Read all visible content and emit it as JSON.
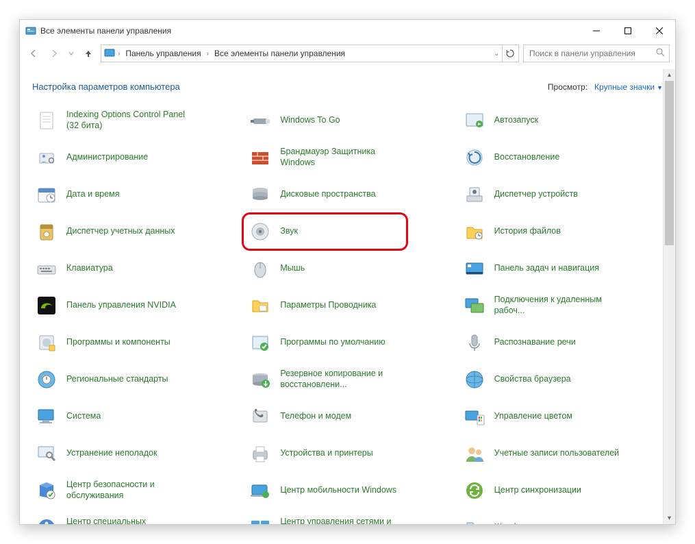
{
  "window_title": "Все элементы панели управления",
  "breadcrumb": {
    "root": "Панель управления",
    "current": "Все элементы панели управления"
  },
  "search_placeholder": "Поиск в панели управления",
  "page_heading": "Настройка параметров компьютера",
  "view_by_label": "Просмотр:",
  "view_by_value": "Крупные значки",
  "highlighted_index": 10,
  "items": [
    {
      "label": "Indexing Options Control Panel (32 бита)",
      "icon": "document"
    },
    {
      "label": "Windows To Go",
      "icon": "usb"
    },
    {
      "label": "Автозапуск",
      "icon": "autoplay"
    },
    {
      "label": "Администрирование",
      "icon": "admin"
    },
    {
      "label": "Брандмауэр Защитника Windows",
      "icon": "firewall"
    },
    {
      "label": "Восстановление",
      "icon": "recovery"
    },
    {
      "label": "Дата и время",
      "icon": "datetime"
    },
    {
      "label": "Дисковые пространства",
      "icon": "storage"
    },
    {
      "label": "Диспетчер устройств",
      "icon": "devmgr"
    },
    {
      "label": "Диспетчер учетных данных",
      "icon": "credmgr"
    },
    {
      "label": "Звук",
      "icon": "sound"
    },
    {
      "label": "История файлов",
      "icon": "filehist"
    },
    {
      "label": "Клавиатура",
      "icon": "keyboard"
    },
    {
      "label": "Мышь",
      "icon": "mouse"
    },
    {
      "label": "Панель задач и навигация",
      "icon": "taskbar"
    },
    {
      "label": "Панель управления NVIDIA",
      "icon": "nvidia"
    },
    {
      "label": "Параметры Проводника",
      "icon": "explorer"
    },
    {
      "label": "Подключения к удаленным рабоч...",
      "icon": "remote"
    },
    {
      "label": "Программы и компоненты",
      "icon": "programs"
    },
    {
      "label": "Программы по умолчанию",
      "icon": "defprog"
    },
    {
      "label": "Распознавание речи",
      "icon": "speech"
    },
    {
      "label": "Региональные стандарты",
      "icon": "region"
    },
    {
      "label": "Резервное копирование и восстановлени...",
      "icon": "backup"
    },
    {
      "label": "Свойства браузера",
      "icon": "inetopt"
    },
    {
      "label": "Система",
      "icon": "system"
    },
    {
      "label": "Телефон и модем",
      "icon": "phone"
    },
    {
      "label": "Управление цветом",
      "icon": "color"
    },
    {
      "label": "Устранение неполадок",
      "icon": "troubleshoot"
    },
    {
      "label": "Устройства и принтеры",
      "icon": "printers"
    },
    {
      "label": "Учетные записи пользователей",
      "icon": "users"
    },
    {
      "label": "Центр безопасности и обслуживания",
      "icon": "security"
    },
    {
      "label": "Центр мобильности Windows",
      "icon": "mobility"
    },
    {
      "label": "Центр синхронизации",
      "icon": "sync"
    },
    {
      "label": "Центр специальных возможностей",
      "icon": "ease"
    },
    {
      "label": "Центр управления сетями и общим доступом",
      "icon": "network"
    },
    {
      "label": "Шрифты",
      "icon": "fonts"
    }
  ]
}
